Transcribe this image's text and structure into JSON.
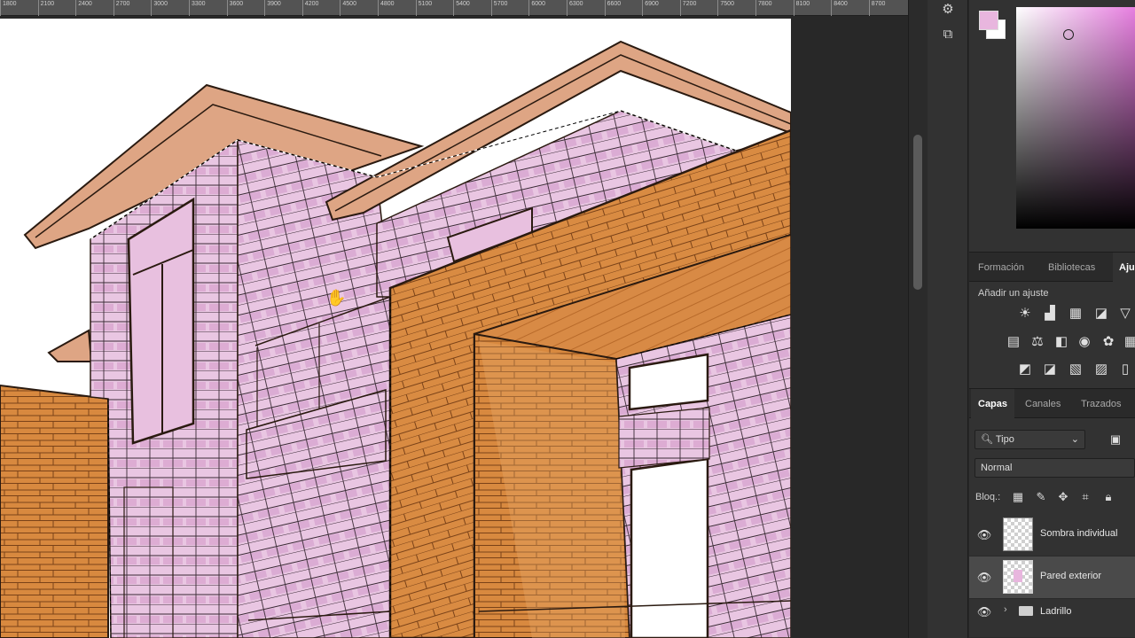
{
  "ruler": {
    "ticks": [
      "1800",
      "2100",
      "2400",
      "2700",
      "3000",
      "3300",
      "3600",
      "3900",
      "4200",
      "4500",
      "4800",
      "5100",
      "5400",
      "5700",
      "6000",
      "6300",
      "6600",
      "6900",
      "7200",
      "7500",
      "7800",
      "8100",
      "8400",
      "8700"
    ]
  },
  "colors": {
    "foreground": "#e8b6de",
    "background": "#ffffff",
    "accent": "#e77fe0",
    "wall_pink": "#e8c3e0",
    "brick": "#d8893f",
    "roof": "#dea584"
  },
  "panels": {
    "tabs_top": [
      {
        "label": "Formación"
      },
      {
        "label": "Bibliotecas"
      },
      {
        "label": "Aju"
      }
    ],
    "adjustments": {
      "title": "Añadir un ajuste",
      "icons": [
        "brightness-icon",
        "levels-icon",
        "curves-icon",
        "exposure-icon",
        "vibrance-icon",
        "hue-saturation-icon",
        "color-balance-icon",
        "black-white-icon",
        "photo-filter-icon",
        "channel-mixer-icon",
        "color-lookup-icon",
        "invert-icon",
        "posterize-icon",
        "threshold-icon",
        "gradient-map-icon",
        "selective-color-icon"
      ]
    },
    "layers_tabs": [
      {
        "label": "Capas"
      },
      {
        "label": "Canales"
      },
      {
        "label": "Trazados"
      }
    ],
    "filter_kind": "Tipo",
    "blend_mode": "Normal",
    "lock_label": "Bloq.:",
    "layers": [
      {
        "name": "Sombra individual"
      },
      {
        "name": "Pared exterior"
      },
      {
        "name": "Ladrillo"
      }
    ]
  }
}
